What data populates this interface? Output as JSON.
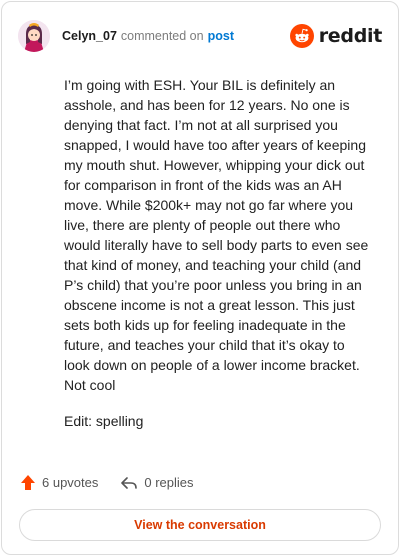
{
  "header": {
    "username": "Celyn_07",
    "commented_text": "commented on",
    "post_link": "post",
    "brand": "reddit"
  },
  "comment": {
    "paragraphs": [
      "I’m going with ESH. Your BIL is definitely an asshole, and has been for 12 years. No one is denying that fact. I’m not at all surprised you snapped, I would have too after years of keeping my mouth shut. However, whipping your dick out for comparison in front of the kids was an AH move. While $200k+ may not go far where you live, there are plenty of people out there who would literally have to sell body parts to even see that kind of money, and teaching your child (and P’s child) that you’re poor unless you bring in an obscene income is not a great lesson. This just sets both kids up for feeling inadequate in the future, and teaches your child that it’s okay to look down on people of a lower income bracket. Not cool",
      "Edit: spelling"
    ]
  },
  "actions": {
    "upvotes": "6 upvotes",
    "replies": "0 replies"
  },
  "cta": {
    "label": "View the conversation"
  },
  "colors": {
    "accent": "#ff4500",
    "link": "#0079d3",
    "cta_text": "#d93a00"
  },
  "icons": {
    "avatar": "avatar",
    "brand_logo": "reddit-snoo-icon",
    "upvote": "upvote-arrow-icon",
    "reply": "reply-arrow-icon"
  }
}
